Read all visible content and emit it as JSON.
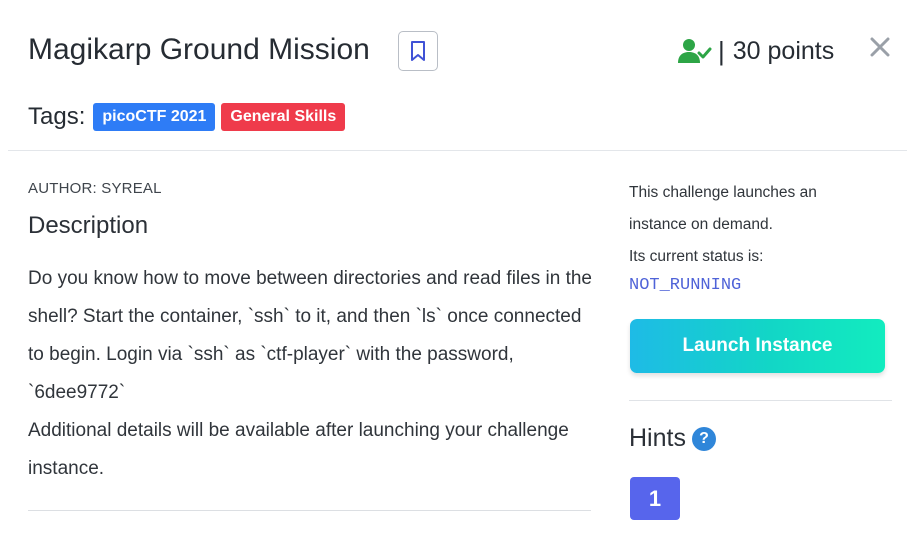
{
  "challenge": {
    "title": "Magikarp Ground Mission",
    "points_separator": "|",
    "points": "30 points",
    "icons": {
      "bookmark": "bookmark-icon",
      "solved": "user-check-icon",
      "close": "close-icon"
    },
    "colors": {
      "solved_icon": "#2da546",
      "bookmark_icon": "#4052d6",
      "close_icon": "#9aa0a8"
    }
  },
  "tags": {
    "label": "Tags:",
    "items": [
      {
        "label": "picoCTF 2021",
        "color": "#2e7cf6"
      },
      {
        "label": "General Skills",
        "color": "#ef3b4b"
      }
    ]
  },
  "description": {
    "author": "AUTHOR: SYREAL",
    "heading": "Description",
    "body": "Do you know how to move between directories and read files in the shell? Start the container, `ssh` to it, and then `ls` once connected to begin. Login via `ssh` as `ctf-player` with the password, `6dee9772`",
    "note": "Additional details will be available after launching your challenge instance."
  },
  "instance": {
    "line1": "This challenge launches an instance on demand.",
    "line2": "Its current status is:",
    "status": "NOT_RUNNING",
    "status_color": "#4f63d8",
    "launch_label": "Launch Instance"
  },
  "hints": {
    "heading": "Hints",
    "help_symbol": "?",
    "items": [
      "1"
    ]
  }
}
